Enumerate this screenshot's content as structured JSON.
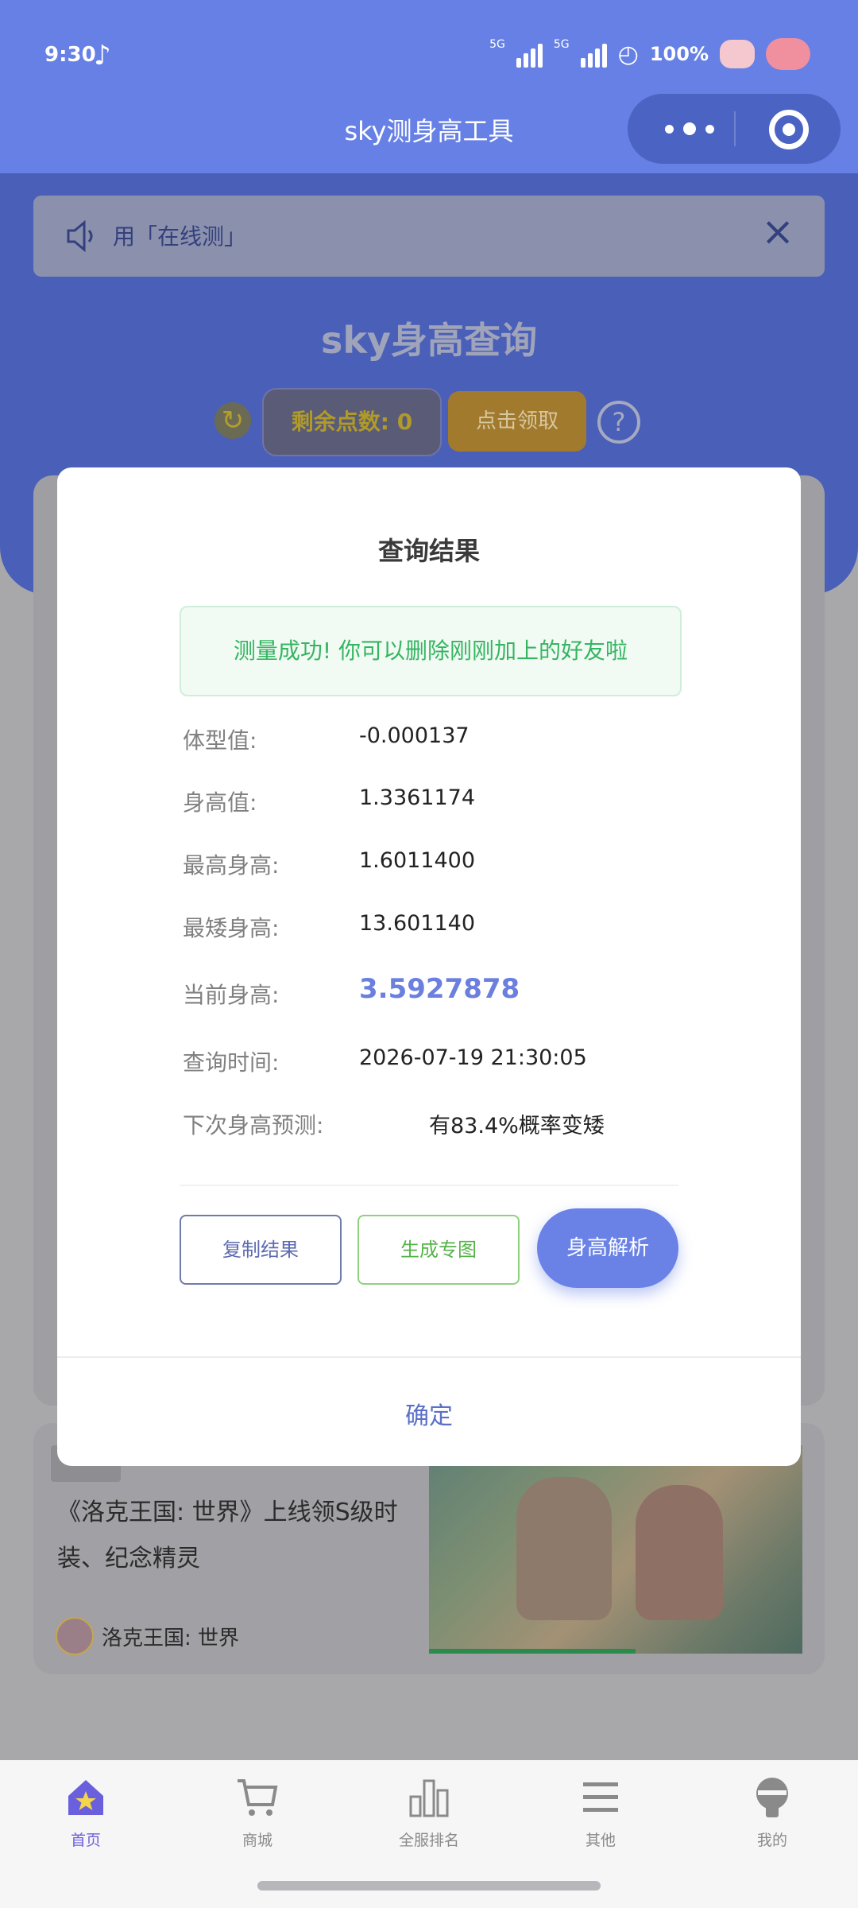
{
  "status_bar": {
    "time": "9:30",
    "signal1": "5G",
    "signal2": "5G",
    "battery": "100%"
  },
  "app": {
    "title": "sky测身高工具"
  },
  "notice": {
    "text": "用「在线测」"
  },
  "hero": {
    "title": "sky身高查询",
    "points": "剩余点数: 0",
    "claim": "点击领取",
    "help": "?"
  },
  "dialog": {
    "title": "查询结果",
    "success": "测量成功! 你可以删除刚刚加上的好友啦",
    "rows": [
      {
        "label": "体型值:",
        "value": "-0.000137"
      },
      {
        "label": "身高值:",
        "value": "1.3361174"
      },
      {
        "label": "最高身高:",
        "value": "1.6011400"
      },
      {
        "label": "最矮身高:",
        "value": "13.601140"
      },
      {
        "label": "当前身高:",
        "value": "3.5927878"
      },
      {
        "label": "查询时间:",
        "value": "2026-07-19  21:30:05"
      },
      {
        "label": "下次身高预测:",
        "value": "有83.4%概率变矮"
      }
    ],
    "buttons": {
      "copy": "复制结果",
      "generate": "生成专图",
      "parse": "身高解析"
    },
    "confirm": "确定"
  },
  "news": {
    "title": "《洛克王国: 世界》上线领S级时装、纪念精灵",
    "source": "洛克王国: 世界"
  },
  "tabbar": {
    "active_color": "#6a5fdc",
    "items": [
      {
        "label": "首页",
        "icon": "home-star-icon"
      },
      {
        "label": "商城",
        "icon": "cart-icon"
      },
      {
        "label": "全服排名",
        "icon": "ranking-bars-icon"
      },
      {
        "label": "其他",
        "icon": "menu-icon"
      },
      {
        "label": "我的",
        "icon": "profile-icon"
      }
    ]
  },
  "colors": {
    "primary": "#6680e6",
    "success": "#35b561",
    "accent": "#6a82e6"
  }
}
